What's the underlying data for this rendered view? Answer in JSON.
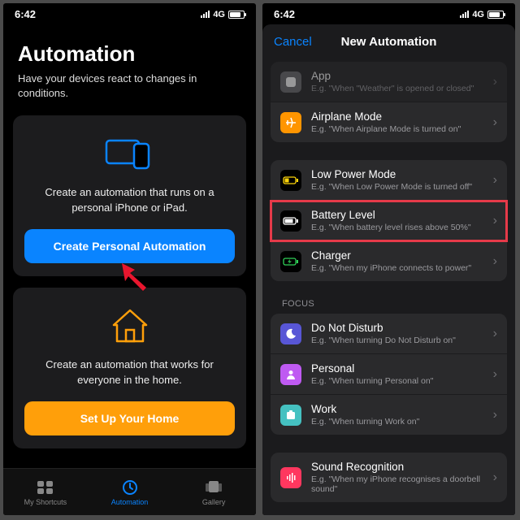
{
  "status": {
    "time": "6:42",
    "net": "4G"
  },
  "left": {
    "title": "Automation",
    "subtitle": "Have your devices react to changes in conditions.",
    "personal": {
      "desc": "Create an automation that runs on a personal iPhone or iPad.",
      "button": "Create Personal Automation"
    },
    "home": {
      "desc": "Create an automation that works for everyone in the home.",
      "button": "Set Up Your Home"
    },
    "tabs": {
      "shortcuts": "My Shortcuts",
      "automation": "Automation",
      "gallery": "Gallery"
    }
  },
  "right": {
    "cancel": "Cancel",
    "title": "New Automation",
    "g1": {
      "app": {
        "title": "App",
        "desc": "E.g. \"When \"Weather\" is opened or closed\""
      },
      "airplane": {
        "title": "Airplane Mode",
        "desc": "E.g. \"When Airplane Mode is turned on\""
      }
    },
    "g2": {
      "lpm": {
        "title": "Low Power Mode",
        "desc": "E.g. \"When Low Power Mode is turned off\""
      },
      "battery": {
        "title": "Battery Level",
        "desc": "E.g. \"When battery level rises above 50%\""
      },
      "charger": {
        "title": "Charger",
        "desc": "E.g. \"When my iPhone connects to power\""
      }
    },
    "focus_label": "FOCUS",
    "g3": {
      "dnd": {
        "title": "Do Not Disturb",
        "desc": "E.g. \"When turning Do Not Disturb on\""
      },
      "personal": {
        "title": "Personal",
        "desc": "E.g. \"When turning Personal on\""
      },
      "work": {
        "title": "Work",
        "desc": "E.g. \"When turning Work on\""
      }
    },
    "g4": {
      "sound": {
        "title": "Sound Recognition",
        "desc": "E.g. \"When my iPhone recognises a doorbell sound\""
      }
    }
  }
}
